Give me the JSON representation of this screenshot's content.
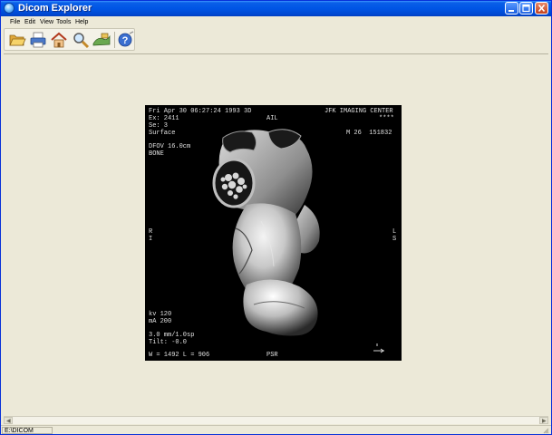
{
  "window": {
    "title": "Dicom Explorer"
  },
  "menu": {
    "file": "File",
    "edit": "Edit",
    "view": "View",
    "tools": "Tools",
    "help": "Help"
  },
  "toolbar": {
    "buttons": [
      {
        "icon": "open-folder-icon"
      },
      {
        "icon": "print-icon"
      },
      {
        "icon": "home-icon"
      },
      {
        "icon": "magnifier-icon"
      },
      {
        "icon": "network-icon"
      },
      {
        "icon": "help-icon"
      }
    ]
  },
  "image_overlay": {
    "date_line": "Fri Apr 30 06:27:24 1993 3D",
    "exam": "Ex: 2411",
    "series": "Se: 3",
    "mode": "Surface",
    "orientation_top": "AIL",
    "institution": "JFK IMAGING CENTER",
    "patient_name": "****",
    "patient_info": "M 26  151832",
    "dfov": "DFOV 16.0cm",
    "kernel": "BONE",
    "left_marker": "R\nI",
    "right_marker": "L\nS",
    "kv": "kv 120",
    "ma": "mA 200",
    "thickness": "3.0 mm/1.0sp",
    "tilt": "Tilt: -0.0",
    "window_level": "W = 1492 L = 906",
    "orientation_bottom": "PSR"
  },
  "status": {
    "path": "E:\\DICOM"
  }
}
